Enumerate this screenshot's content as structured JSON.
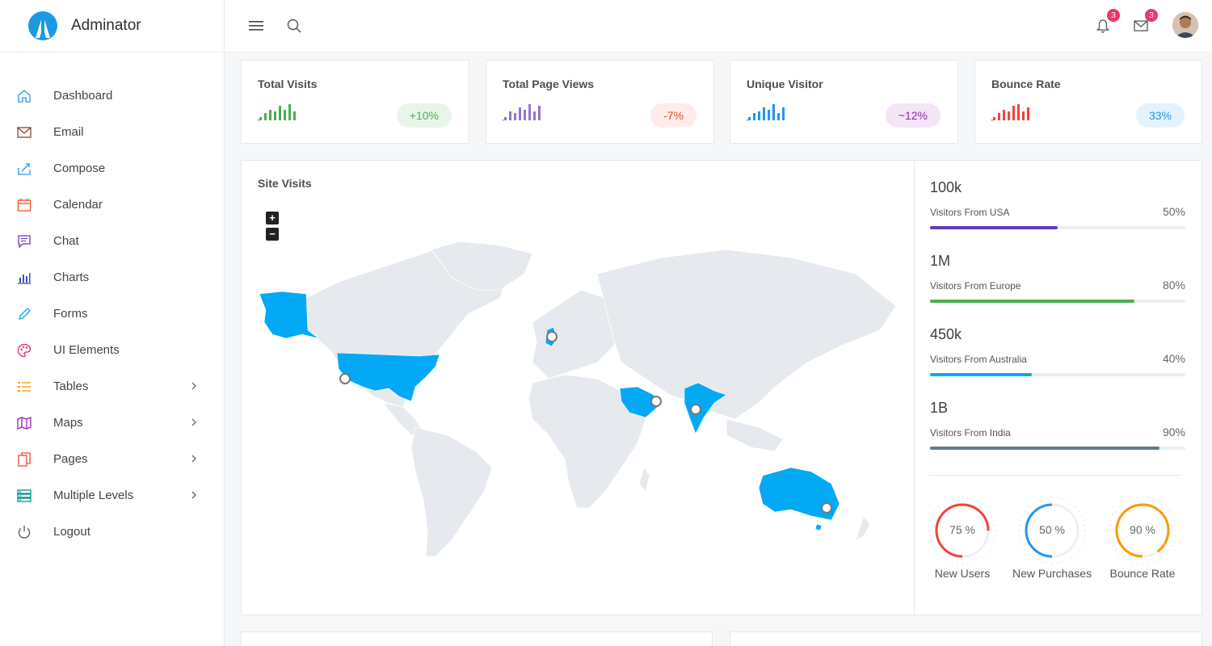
{
  "brand": {
    "name": "Adminator"
  },
  "sidebar": {
    "items": [
      {
        "label": "Dashboard",
        "icon": "home-icon",
        "color": "#2196f3",
        "has_children": false
      },
      {
        "label": "Email",
        "icon": "email-icon",
        "color": "#7d4c31",
        "has_children": false
      },
      {
        "label": "Compose",
        "icon": "compose-icon",
        "color": "#2196f3",
        "has_children": false
      },
      {
        "label": "Calendar",
        "icon": "calendar-icon",
        "color": "#f4511e",
        "has_children": false
      },
      {
        "label": "Chat",
        "icon": "chat-icon",
        "color": "#673ab7",
        "has_children": false
      },
      {
        "label": "Charts",
        "icon": "bar-chart-icon",
        "color": "#3f51b5",
        "has_children": false
      },
      {
        "label": "Forms",
        "icon": "pencil-icon",
        "color": "#03a9f4",
        "has_children": false
      },
      {
        "label": "UI Elements",
        "icon": "palette-icon",
        "color": "#e91e63",
        "has_children": false
      },
      {
        "label": "Tables",
        "icon": "list-icon",
        "color": "#ff9800",
        "has_children": true
      },
      {
        "label": "Maps",
        "icon": "map-icon",
        "color": "#9c27b0",
        "has_children": true
      },
      {
        "label": "Pages",
        "icon": "files-icon",
        "color": "#f44336",
        "has_children": true
      },
      {
        "label": "Multiple Levels",
        "icon": "stack-icon",
        "color": "#009688",
        "has_children": true
      },
      {
        "label": "Logout",
        "icon": "power-icon",
        "color": "#555555",
        "has_children": false
      }
    ]
  },
  "topbar": {
    "notifications_count": "3",
    "messages_count": "3"
  },
  "stats": [
    {
      "title": "Total Visits",
      "change": "+10%",
      "color": "#4caf50",
      "pill_bg": "#e8f5e9",
      "pill_color": "#4caf50",
      "spark": [
        2,
        4,
        6,
        5,
        8,
        6,
        9,
        5
      ]
    },
    {
      "title": "Total Page Views",
      "change": "-7%",
      "color": "#9575cd",
      "pill_bg": "#fdecea",
      "pill_color": "#f44336",
      "spark": [
        2,
        5,
        4,
        7,
        6,
        9,
        5,
        8
      ]
    },
    {
      "title": "Unique Visitor",
      "change": "~12%",
      "color": "#2196f3",
      "pill_bg": "#f3e5f5",
      "pill_color": "#9c27b0",
      "spark": [
        2,
        4,
        5,
        7,
        6,
        9,
        4,
        7
      ]
    },
    {
      "title": "Bounce Rate",
      "change": "33%",
      "color": "#f44336",
      "pill_bg": "#e3f2fd",
      "pill_color": "#2196f3",
      "spark": [
        2,
        4,
        6,
        5,
        8,
        9,
        5,
        7
      ]
    }
  ],
  "site_visits": {
    "title": "Site Visits",
    "zoom_in": "+",
    "zoom_out": "−",
    "highlight_color": "#03a9f4",
    "land_color": "#e6eaee"
  },
  "visitors": [
    {
      "value": "100k",
      "label": "Visitors From USA",
      "percent": "50%",
      "fraction": 0.5,
      "color": "#673ab7"
    },
    {
      "value": "1M",
      "label": "Visitors From Europe",
      "percent": "80%",
      "fraction": 0.8,
      "color": "#4caf50"
    },
    {
      "value": "450k",
      "label": "Visitors From Australia",
      "percent": "40%",
      "fraction": 0.4,
      "color": "#03a9f4"
    },
    {
      "value": "1B",
      "label": "Visitors From India",
      "percent": "90%",
      "fraction": 0.9,
      "color": "#607d8b"
    }
  ],
  "gauges": [
    {
      "value": "75 %",
      "fraction": 0.75,
      "label": "New Users",
      "color": "#f44336"
    },
    {
      "value": "50 %",
      "fraction": 0.5,
      "label": "New Purchases",
      "color": "#2196f3"
    },
    {
      "value": "90 %",
      "fraction": 0.9,
      "label": "Bounce Rate",
      "color": "#ff9800"
    }
  ]
}
